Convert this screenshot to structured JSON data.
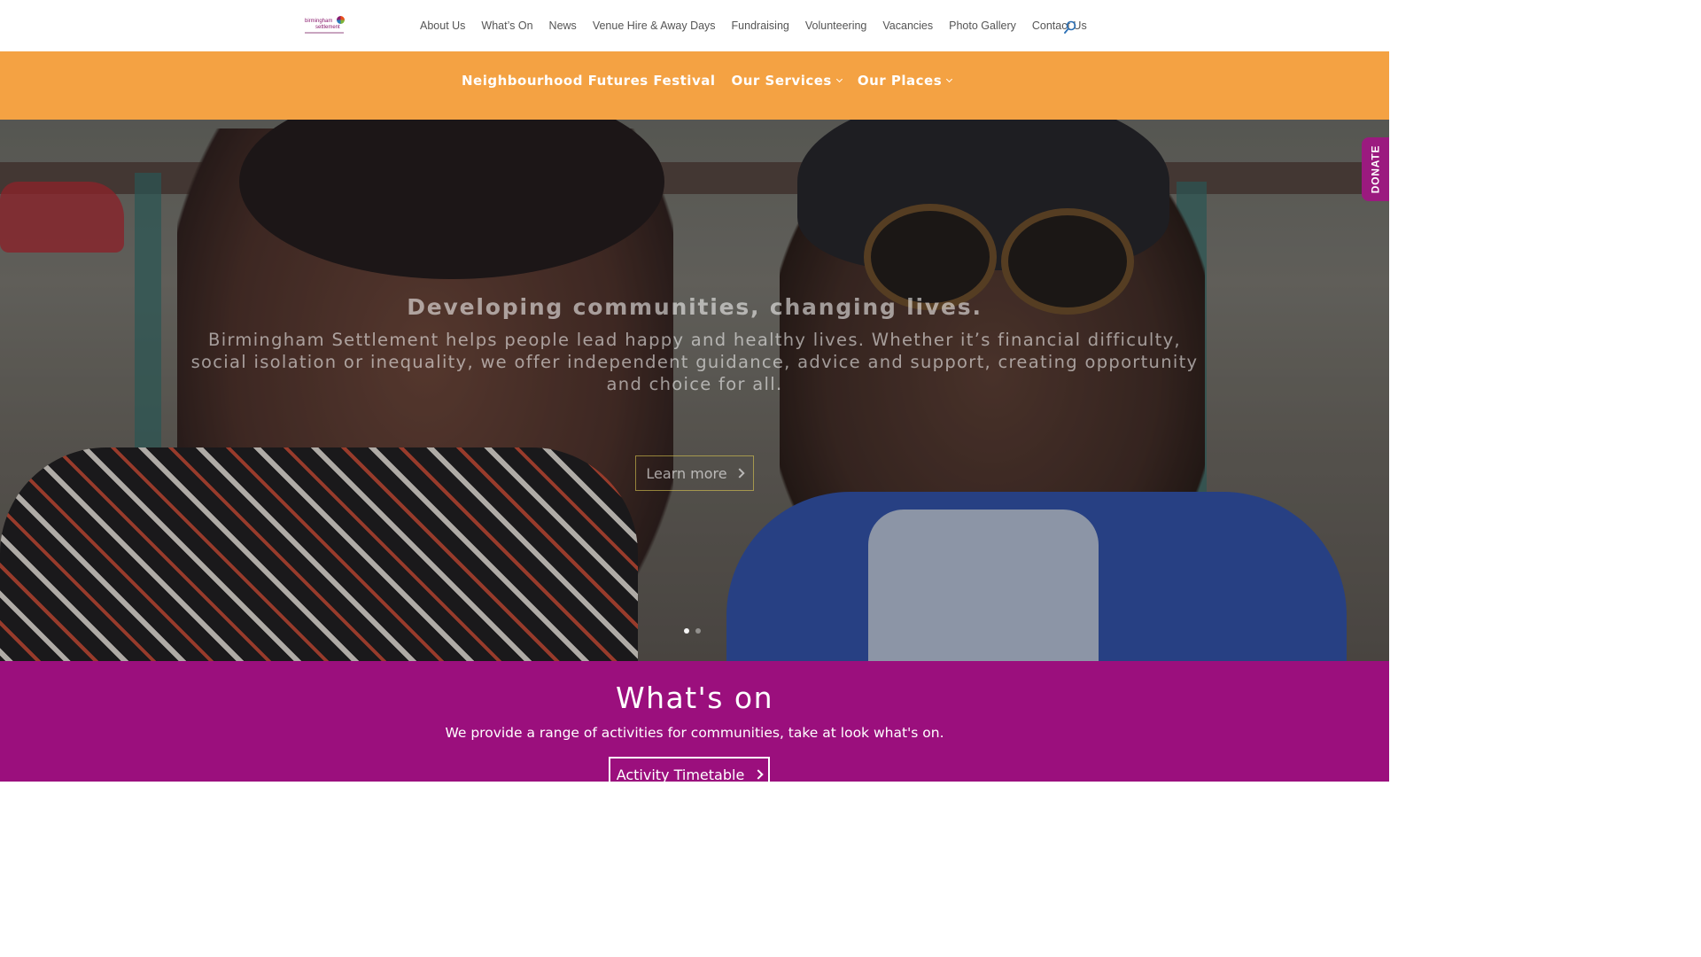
{
  "header": {
    "logo_line1": "birmingham",
    "logo_line2": "settlement",
    "nav": [
      "About Us",
      "What’s On",
      "News",
      "Venue Hire & Away Days",
      "Fundraising",
      "Volunteering",
      "Vacancies",
      "Photo Gallery",
      "Contact Us"
    ],
    "search_icon": "search-icon"
  },
  "main_nav": {
    "items": [
      {
        "label": "Neighbourhood Futures Festival",
        "dropdown": false
      },
      {
        "label": "Our Services",
        "dropdown": true
      },
      {
        "label": "Our Places",
        "dropdown": true
      }
    ]
  },
  "hero": {
    "title": "Developing communities, changing lives.",
    "subtitle": "Birmingham Settlement helps people lead happy and healthy lives. Whether it’s financial difficulty, social isolation or inequality, we offer independent guidance, advice and support, creating opportunity and choice for all.",
    "button_label": "Learn more",
    "slides": 2,
    "active_slide": 1
  },
  "donate": {
    "label": "DONATE"
  },
  "whats_on": {
    "title": "What's on",
    "subtitle": "We provide a range of activities for communities, take at look what's on.",
    "button_label": "Activity Timetable"
  },
  "colors": {
    "orange_bar": "#f4a243",
    "purple": "#9b0f7d",
    "donate": "#9b1a7f"
  }
}
